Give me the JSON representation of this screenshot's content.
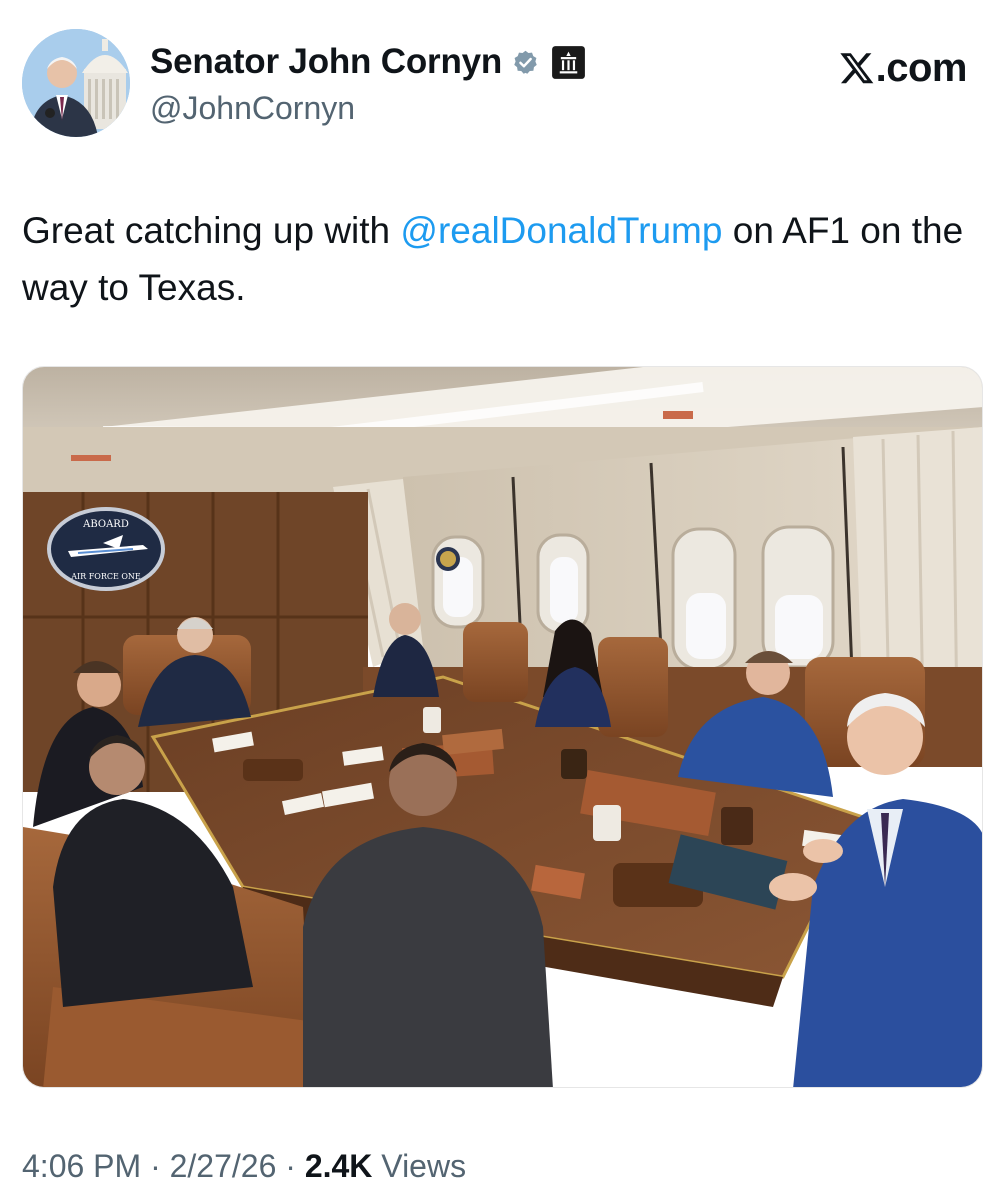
{
  "author": {
    "display_name": "Senator John Cornyn",
    "handle": "@JohnCornyn",
    "verified_icon": "verified-badge-icon",
    "affiliation_icon": "government-building-icon",
    "avatar_icon": "profile-photo"
  },
  "brand": {
    "logo_icon": "x-logo-icon",
    "suffix": ".com"
  },
  "tweet": {
    "text_before": "Great catching up with ",
    "mention": "@realDonaldTrump",
    "text_after": " on AF1 on the way to Texas."
  },
  "photo": {
    "seal_top_text": "ABOARD",
    "seal_bottom_text": "AIR FORCE ONE"
  },
  "meta": {
    "time": "4:06 PM",
    "separator": " · ",
    "date": "2/27/26",
    "views_count": "2.4K",
    "views_label": " Views"
  },
  "colors": {
    "mention": "#1d9bf0",
    "secondary_text": "#536471",
    "primary_text": "#0f1419",
    "verified_badge": "#829aab"
  }
}
